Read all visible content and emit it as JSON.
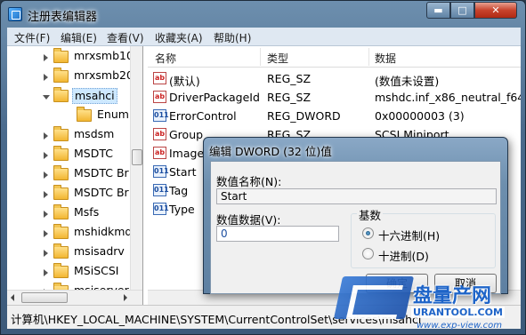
{
  "window": {
    "title": "注册表编辑器",
    "controls": {
      "minimize": "▬",
      "maximize": "□",
      "close": "✕"
    }
  },
  "menu": [
    "文件(F)",
    "编辑(E)",
    "查看(V)",
    "收藏夹(A)",
    "帮助(H)"
  ],
  "tree": {
    "items": [
      {
        "label": "mrxsmb10",
        "expanded": false,
        "selected": false,
        "child": false
      },
      {
        "label": "mrxsmb20",
        "expanded": false,
        "selected": false,
        "child": false
      },
      {
        "label": "msahci",
        "expanded": true,
        "selected": true,
        "child": false
      },
      {
        "label": "Enum",
        "expanded": false,
        "selected": false,
        "child": true
      },
      {
        "label": "msdsm",
        "expanded": false,
        "selected": false,
        "child": false
      },
      {
        "label": "MSDTC",
        "expanded": false,
        "selected": false,
        "child": false
      },
      {
        "label": "MSDTC Br",
        "expanded": false,
        "selected": false,
        "child": false
      },
      {
        "label": "MSDTC Br",
        "expanded": false,
        "selected": false,
        "child": false
      },
      {
        "label": "Msfs",
        "expanded": false,
        "selected": false,
        "child": false
      },
      {
        "label": "mshidkmd",
        "expanded": false,
        "selected": false,
        "child": false
      },
      {
        "label": "msisadrv",
        "expanded": false,
        "selected": false,
        "child": false
      },
      {
        "label": "MSiSCSI",
        "expanded": false,
        "selected": false,
        "child": false
      },
      {
        "label": "msiserver",
        "expanded": false,
        "selected": false,
        "child": false
      },
      {
        "label": "MSKSSRV",
        "expanded": false,
        "selected": false,
        "child": false
      }
    ]
  },
  "list": {
    "columns": {
      "name": "名称",
      "type": "类型",
      "data": "数据"
    },
    "rows": [
      {
        "name": "(默认)",
        "type": "REG_SZ",
        "data": "(数值未设置)",
        "icon": "ab"
      },
      {
        "name": "DriverPackageId",
        "type": "REG_SZ",
        "data": "mshdc.inf_x86_neutral_f64b9c",
        "icon": "ab"
      },
      {
        "name": "ErrorControl",
        "type": "REG_DWORD",
        "data": "0x00000003 (3)",
        "icon": "bin"
      },
      {
        "name": "Group",
        "type": "REG_SZ",
        "data": "SCSI Miniport",
        "icon": "ab"
      },
      {
        "name": "Image",
        "type": "",
        "data": "",
        "icon": "ab"
      },
      {
        "name": "Start",
        "type": "",
        "data": "",
        "icon": "bin"
      },
      {
        "name": "Tag",
        "type": "",
        "data": "",
        "icon": "bin"
      },
      {
        "name": "Type",
        "type": "",
        "data": "",
        "icon": "bin"
      }
    ]
  },
  "statusbar": {
    "path": "计算机\\HKEY_LOCAL_MACHINE\\SYSTEM\\CurrentControlSet\\services\\msahci"
  },
  "dialog": {
    "title": "编辑 DWORD (32 位)值",
    "name_label": "数值名称(N):",
    "name_value": "Start",
    "data_label": "数值数据(V):",
    "data_value": "0",
    "base_label": "基数",
    "hex_label": "十六进制(H)",
    "dec_label": "十进制(D)",
    "hex_selected": true,
    "ok_label": "确定",
    "cancel_label": "取消"
  },
  "watermark": {
    "brand": "盘量产网",
    "url": "URANTOOL.COM",
    "url2": "www.exp-view.com"
  }
}
